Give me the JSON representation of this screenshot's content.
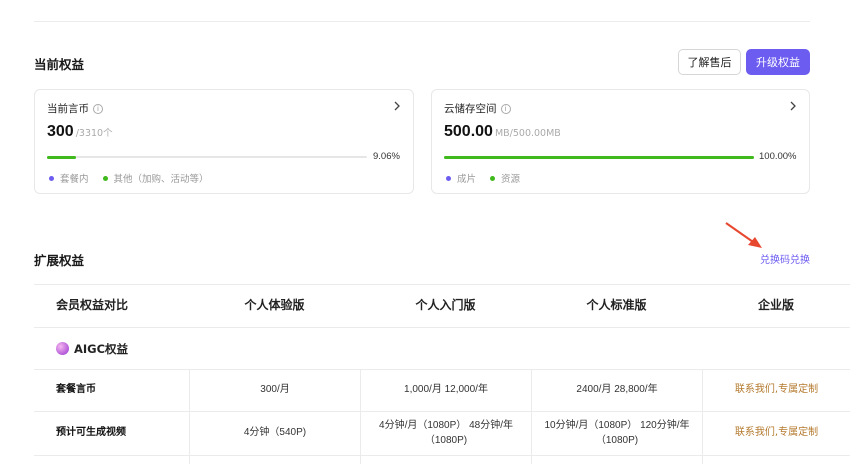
{
  "current": {
    "title": "当前权益",
    "after_sales_label": "了解售后",
    "upgrade_label": "升级权益",
    "coins": {
      "title": "当前言币",
      "info_icon": "info-icon",
      "value": "300",
      "total": "/3310个",
      "percent_text": "9.06%",
      "progress": 0.0906,
      "legend": [
        "套餐内",
        "其他（加购、活动等）"
      ],
      "legend_colors": [
        "#6c5cf0",
        "#3fb91b"
      ]
    },
    "storage": {
      "title": "云储存空间",
      "info_icon": "info-icon",
      "value": "500.00",
      "total": "MB/500.00MB",
      "percent_text": "100.00%",
      "progress": 1.0,
      "legend": [
        "成片",
        "资源"
      ],
      "legend_colors": [
        "#6c5cf0",
        "#3fb91b"
      ]
    }
  },
  "extended": {
    "title": "扩展权益",
    "redeem_label": "兑换码兑换"
  },
  "comparison": {
    "headers": [
      "会员权益对比",
      "个人体验版",
      "个人入门版",
      "个人标准版",
      "企业版"
    ],
    "section": "AIGC权益",
    "rows": [
      {
        "label": "套餐言币",
        "cells": [
          "300/月",
          "1,000/月  12,000/年",
          "2400/月  28,800/年",
          "联系我们,专属定制"
        ]
      },
      {
        "label": "预计可生成视频",
        "cells": [
          "4分钟（540P)",
          "4分钟/月（1080P）  48分钟/年（1080P)",
          "10分钟/月（1080P）  120分钟/年（1080P)",
          "联系我们,专属定制"
        ]
      }
    ]
  },
  "colors": {
    "accent": "#6c5cf0",
    "progress": "#3fb91b",
    "enterprise_text": "#b47a2e",
    "arrow": "#e8472f"
  }
}
